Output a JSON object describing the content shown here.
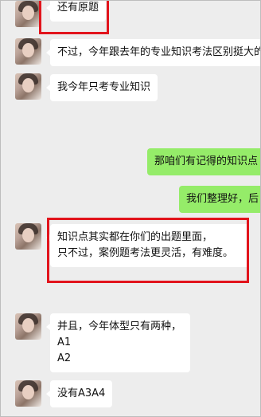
{
  "chat": {
    "messages": [
      {
        "side": "left",
        "text": "还有原题"
      },
      {
        "side": "left",
        "text": "不过，今年跟去年的专业知识考法区别挺大的"
      },
      {
        "side": "left",
        "text": "我今年只考专业知识"
      },
      {
        "side": "right",
        "text": "那咱们有记得的知识点"
      },
      {
        "side": "right",
        "text": "我们整理好，后"
      },
      {
        "side": "left",
        "lines": [
          "知识点其实都在你们的出题里面，",
          "只不过，案例题考法更灵活，有难度。"
        ]
      },
      {
        "side": "left",
        "lines": [
          "并且，今年体型只有两种，",
          "A1",
          "A2"
        ]
      },
      {
        "side": "left",
        "text": "没有A3A4"
      }
    ]
  },
  "colors": {
    "background": "#ededed",
    "incoming_bubble": "#ffffff",
    "outgoing_bubble": "#95ec69",
    "highlight": "#e2141c"
  }
}
